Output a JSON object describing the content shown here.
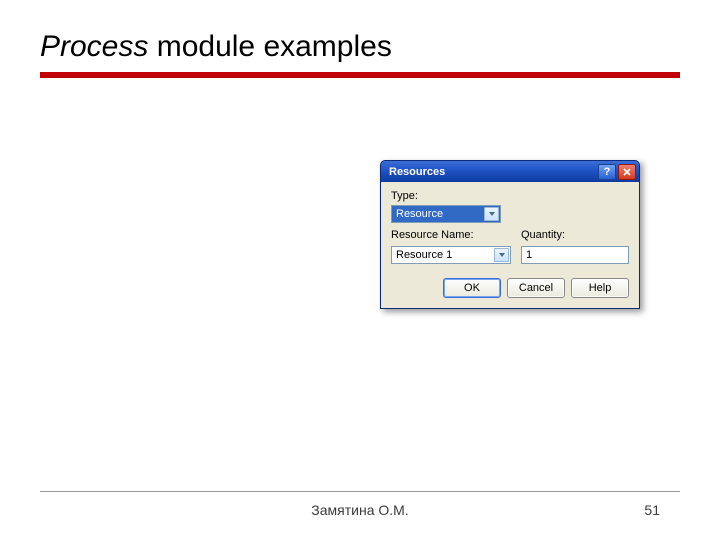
{
  "title": {
    "italic": "Process",
    "rest": " module examples"
  },
  "dialog": {
    "title": "Resources",
    "labels": {
      "type": "Type:",
      "resource_name": "Resource Name:",
      "quantity": "Quantity:"
    },
    "values": {
      "type": "Resource",
      "resource_name": "Resource 1",
      "quantity": "1"
    },
    "buttons": {
      "ok": "OK",
      "cancel": "Cancel",
      "help": "Help"
    }
  },
  "footer": {
    "author": "Замятина О.М.",
    "page": "51"
  }
}
